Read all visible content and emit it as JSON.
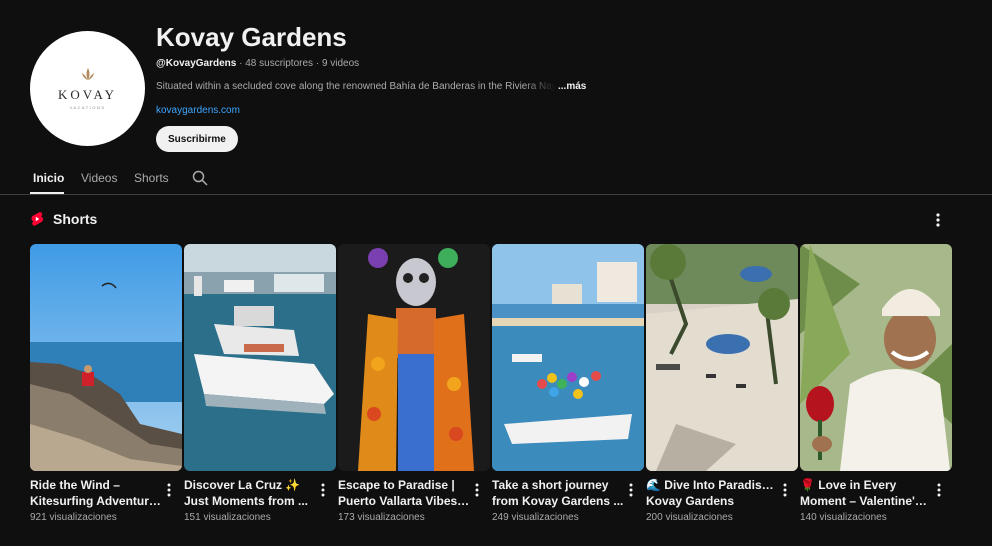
{
  "channel": {
    "avatar_brand": "KOVAY",
    "avatar_sub": "VACATIONS",
    "name": "Kovay Gardens",
    "handle": "@KovayGardens",
    "subscribers": "48 suscriptores",
    "videos": "9 videos",
    "description": "Situated within a secluded cove along the renowned Bahía de Banderas in the Riviera Nayarit",
    "more": "...más",
    "website": "kovaygardens.com",
    "subscribe_label": "Suscribirme"
  },
  "tabs": [
    {
      "label": "Inicio",
      "active": true
    },
    {
      "label": "Videos",
      "active": false
    },
    {
      "label": "Shorts",
      "active": false
    }
  ],
  "section": {
    "title": "Shorts"
  },
  "shorts": [
    {
      "title_line1": "Ride the Wind –",
      "title_line2": "Kitesurfing Adventure...",
      "views": "921 visualizaciones"
    },
    {
      "title_line1": "Discover La Cruz ✨",
      "title_line2": "Just Moments from ...",
      "views": "151 visualizaciones"
    },
    {
      "title_line1": "Escape to Paradise |",
      "title_line2": "Puerto Vallarta Vibes ...",
      "views": "173 visualizaciones"
    },
    {
      "title_line1": "Take a short journey",
      "title_line2": "from Kovay Gardens ...",
      "views": "249 visualizaciones"
    },
    {
      "title_line1": "🌊 Dive Into Paradise at",
      "title_line2": "Kovay Gardens",
      "views": "200 visualizaciones"
    },
    {
      "title_line1": "🌹 Love in Every",
      "title_line2": "Moment – Valentine's ...",
      "views": "140 visualizaciones"
    }
  ],
  "colors": {
    "background": "#0f0f0f",
    "link": "#3ea6ff",
    "shorts_red": "#ff0033"
  }
}
